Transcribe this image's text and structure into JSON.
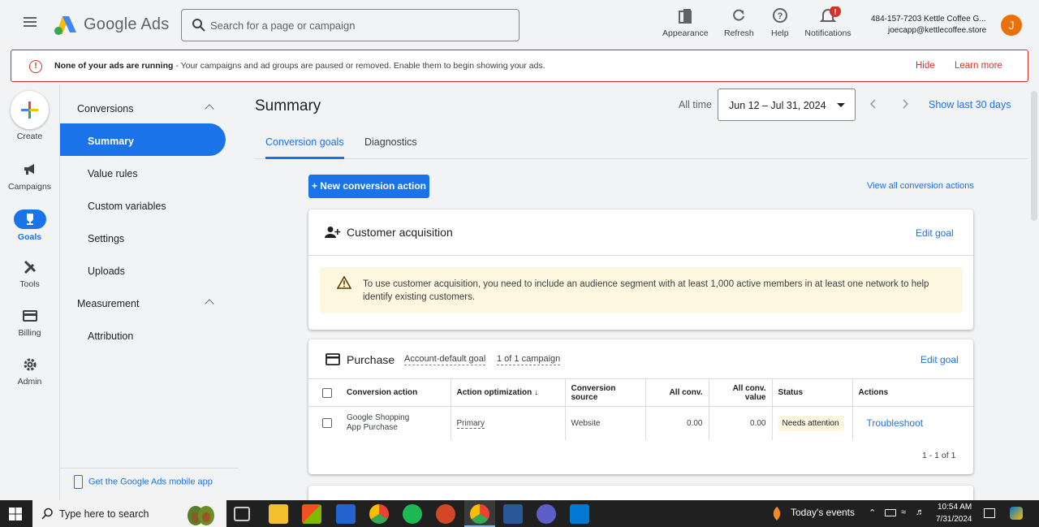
{
  "header": {
    "brand": "Google Ads",
    "search_placeholder": "Search for a page or campaign",
    "tools": [
      {
        "label": "Appearance",
        "icon": "appearance-icon"
      },
      {
        "label": "Refresh",
        "icon": "refresh-icon"
      },
      {
        "label": "Help",
        "icon": "help-icon"
      },
      {
        "label": "Notifications",
        "icon": "bell-icon",
        "badge": "!"
      }
    ],
    "account_line1": "484-157-7203 Kettle Coffee G...",
    "account_line2": "joecapp@kettlecoffee.store",
    "avatar_letter": "J"
  },
  "banner": {
    "title": "None of your ads are running",
    "message": " - Your campaigns and ad groups are paused or removed. Enable them to begin showing your ads.",
    "hide": "Hide",
    "learn_more": "Learn more",
    "color": "#d93025"
  },
  "rail": {
    "create": "Create",
    "items": [
      {
        "label": "Campaigns",
        "icon": "megaphone-icon"
      },
      {
        "label": "Goals",
        "icon": "trophy-icon",
        "active": true
      },
      {
        "label": "Tools",
        "icon": "tools-icon"
      },
      {
        "label": "Billing",
        "icon": "credit-card-icon"
      },
      {
        "label": "Admin",
        "icon": "gear-icon"
      }
    ]
  },
  "leftnav": {
    "section1": "Conversions",
    "items1": [
      "Summary",
      "Value rules",
      "Custom variables",
      "Settings",
      "Uploads"
    ],
    "section2": "Measurement",
    "items2": [
      "Attribution"
    ],
    "mobile_app": "Get the Google Ads mobile app"
  },
  "main": {
    "title": "Summary",
    "all_time": "All time",
    "date_range": "Jun 12 – Jul 31, 2024",
    "show_last": "Show last 30 days",
    "tabs": [
      "Conversion goals",
      "Diagnostics"
    ],
    "new_action": "+ New conversion action",
    "view_all": "View all conversion actions"
  },
  "card_acquisition": {
    "title": "Customer acquisition",
    "edit": "Edit goal",
    "warning": "To use customer acquisition, you need to include an audience segment with at least 1,000 active members in at least one network to help identify existing customers."
  },
  "card_purchase": {
    "title": "Purchase",
    "tag1": "Account-default goal",
    "tag2": "1 of 1 campaign",
    "edit": "Edit goal",
    "columns": [
      "Conversion action",
      "Action optimization",
      "Conversion source",
      "All conv.",
      "All conv. value",
      "Status",
      "Actions"
    ],
    "row": {
      "action_line1": "Google Shopping",
      "action_line2": "App Purchase",
      "optimization": "Primary",
      "source": "Website",
      "all_conv": "0.00",
      "all_conv_value": "0.00",
      "status": "Needs attention",
      "action": "Troubleshoot"
    },
    "pager": "1 - 1 of 1"
  },
  "taskbar": {
    "search_placeholder": "Type here to search",
    "events": "Today's events",
    "time": "10:54 AM",
    "date": "7/31/2024"
  }
}
